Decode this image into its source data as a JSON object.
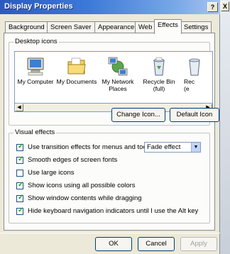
{
  "window": {
    "title": "Display Properties",
    "help_label": "?",
    "close_label": "X"
  },
  "tabs": [
    {
      "label": "Background"
    },
    {
      "label": "Screen Saver"
    },
    {
      "label": "Appearance"
    },
    {
      "label": "Web"
    },
    {
      "label": "Effects",
      "active": true
    },
    {
      "label": "Settings"
    }
  ],
  "desktop_icons": {
    "legend": "Desktop icons",
    "items": [
      {
        "label_line1": "My Computer",
        "label_line2": "",
        "icon": "my-computer-icon"
      },
      {
        "label_line1": "My Documents",
        "label_line2": "",
        "icon": "my-documents-icon"
      },
      {
        "label_line1": "My Network",
        "label_line2": "Places",
        "icon": "network-places-icon"
      },
      {
        "label_line1": "Recycle Bin",
        "label_line2": "(full)",
        "icon": "recycle-bin-icon"
      },
      {
        "label_line1": "Rec",
        "label_line2": "(e",
        "icon": "recycle-bin-empty-icon"
      }
    ],
    "change_icon_label": "Change Icon...",
    "default_icon_label": "Default Icon"
  },
  "visual_effects": {
    "legend": "Visual effects",
    "options": [
      {
        "label": "Use transition effects for menus and tooltips",
        "checked": true
      },
      {
        "label": "Smooth edges of screen fonts",
        "checked": true
      },
      {
        "label": "Use large icons",
        "checked": false
      },
      {
        "label": "Show icons using all possible colors",
        "checked": true
      },
      {
        "label": "Show window contents while dragging",
        "checked": true
      },
      {
        "label": "Hide keyboard navigation indicators until I use the Alt key",
        "checked": true
      }
    ],
    "transition_effect": "Fade effect"
  },
  "buttons": {
    "ok": "OK",
    "cancel": "Cancel",
    "apply": "Apply"
  },
  "colors": {
    "titlebar": "#2a5bbf",
    "dialog_bg": "#ece9d8",
    "check": "#21a121"
  }
}
